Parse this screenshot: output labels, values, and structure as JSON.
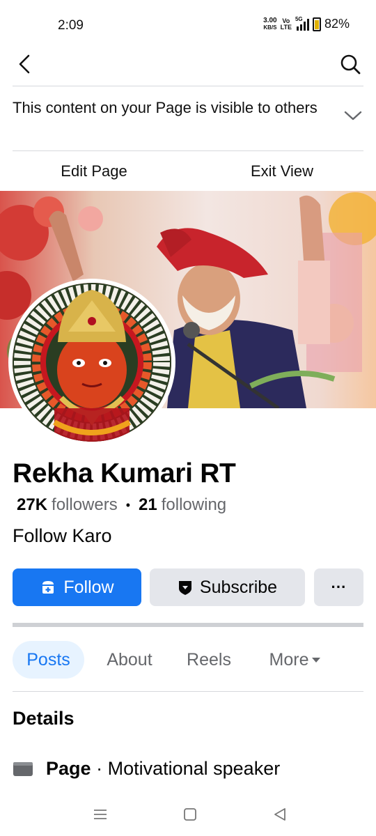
{
  "status_bar": {
    "time": "2:09",
    "net_speed": "3.00",
    "net_speed_unit": "KB/S",
    "volte_top": "Vo",
    "volte_bottom": "LTE",
    "network": "5G",
    "battery": "82%"
  },
  "header": {
    "back_icon": "chevron-left-icon",
    "search_icon": "search-icon"
  },
  "notice": {
    "text": "This content on your Page is visible to others",
    "icon": "chevron-down-icon"
  },
  "actions": {
    "edit_label": "Edit Page",
    "exit_label": "Exit View"
  },
  "profile": {
    "name": "Rekha Kumari RT",
    "followers_count": "27K",
    "followers_label": "followers",
    "separator": "•",
    "following_count": "21",
    "following_label": "following",
    "bio": "Follow Karo"
  },
  "buttons": {
    "follow_label": "Follow",
    "subscribe_label": "Subscribe",
    "more_label": "···"
  },
  "tabs": [
    {
      "label": "Posts",
      "active": true
    },
    {
      "label": "About",
      "active": false
    },
    {
      "label": "Reels",
      "active": false
    },
    {
      "label": "More",
      "active": false
    }
  ],
  "details": {
    "title": "Details",
    "category_label": "Page",
    "category_separator": "·",
    "category_value": "Motivational speaker"
  },
  "colors": {
    "accent": "#1877f2",
    "tab_active_bg": "#e7f3ff",
    "secondary_button_bg": "#e4e6eb",
    "muted_text": "#65676b"
  }
}
